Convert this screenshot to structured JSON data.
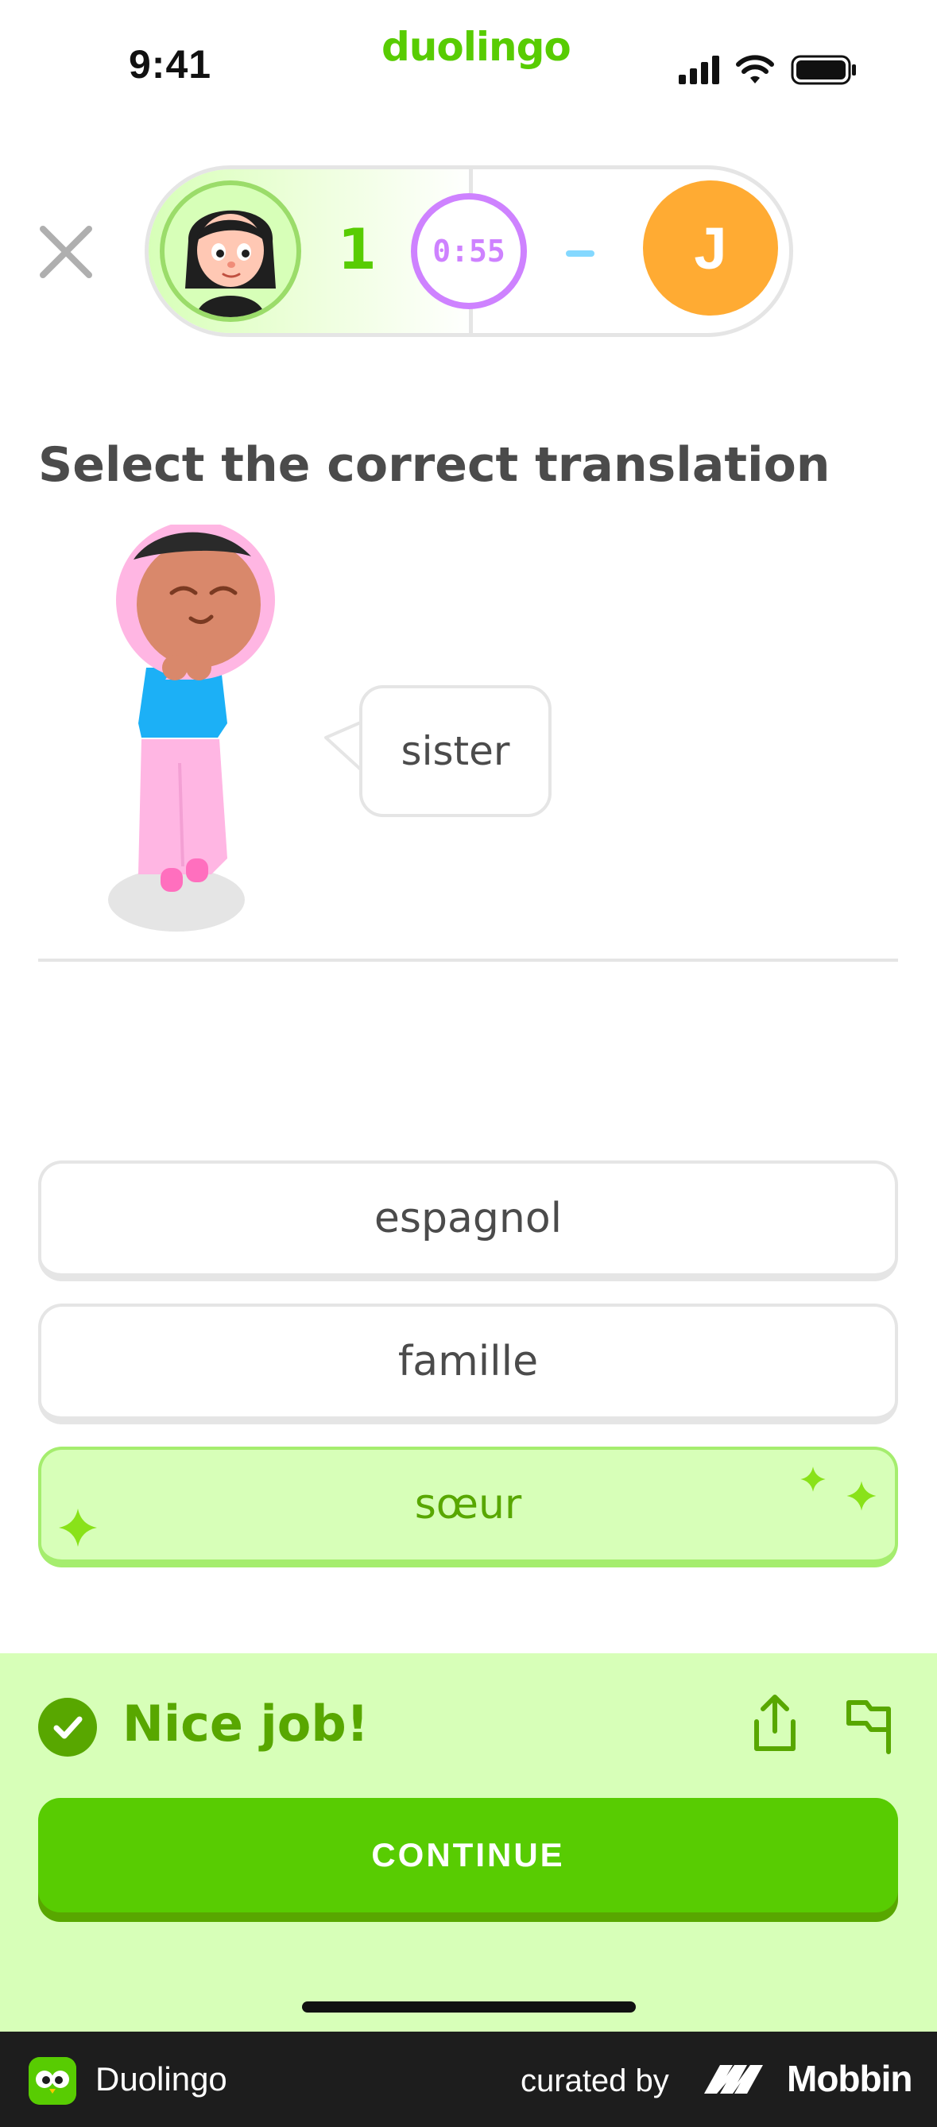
{
  "status_bar": {
    "time": "9:41",
    "brand": "duolingo",
    "icons": [
      "cellular-signal-icon",
      "wifi-icon",
      "battery-icon"
    ]
  },
  "header": {
    "close_icon": "close-icon",
    "user_score": "1",
    "timer": "0:55",
    "opponent_score": "-",
    "opponent_initial": "J",
    "colors": {
      "user_ring": "#9bdc6a",
      "timer": "#ce82ff",
      "opponent": "#ffab33"
    }
  },
  "prompt": {
    "title": "Select the correct translation",
    "speech": "sister"
  },
  "choices": [
    {
      "label": "espagnol",
      "state": "default"
    },
    {
      "label": "famille",
      "state": "default"
    },
    {
      "label": "sœur",
      "state": "correct"
    }
  ],
  "feedback": {
    "title": "Nice job!",
    "icons": [
      "check-icon",
      "share-icon",
      "flag-icon"
    ],
    "continue_label": "CONTINUE",
    "colors": {
      "panel": "#d7ffb8",
      "accent": "#58a700",
      "button": "#58cc02"
    }
  },
  "banner": {
    "app_name": "Duolingo",
    "curated_by": "curated by",
    "platform": "Mobbin"
  }
}
